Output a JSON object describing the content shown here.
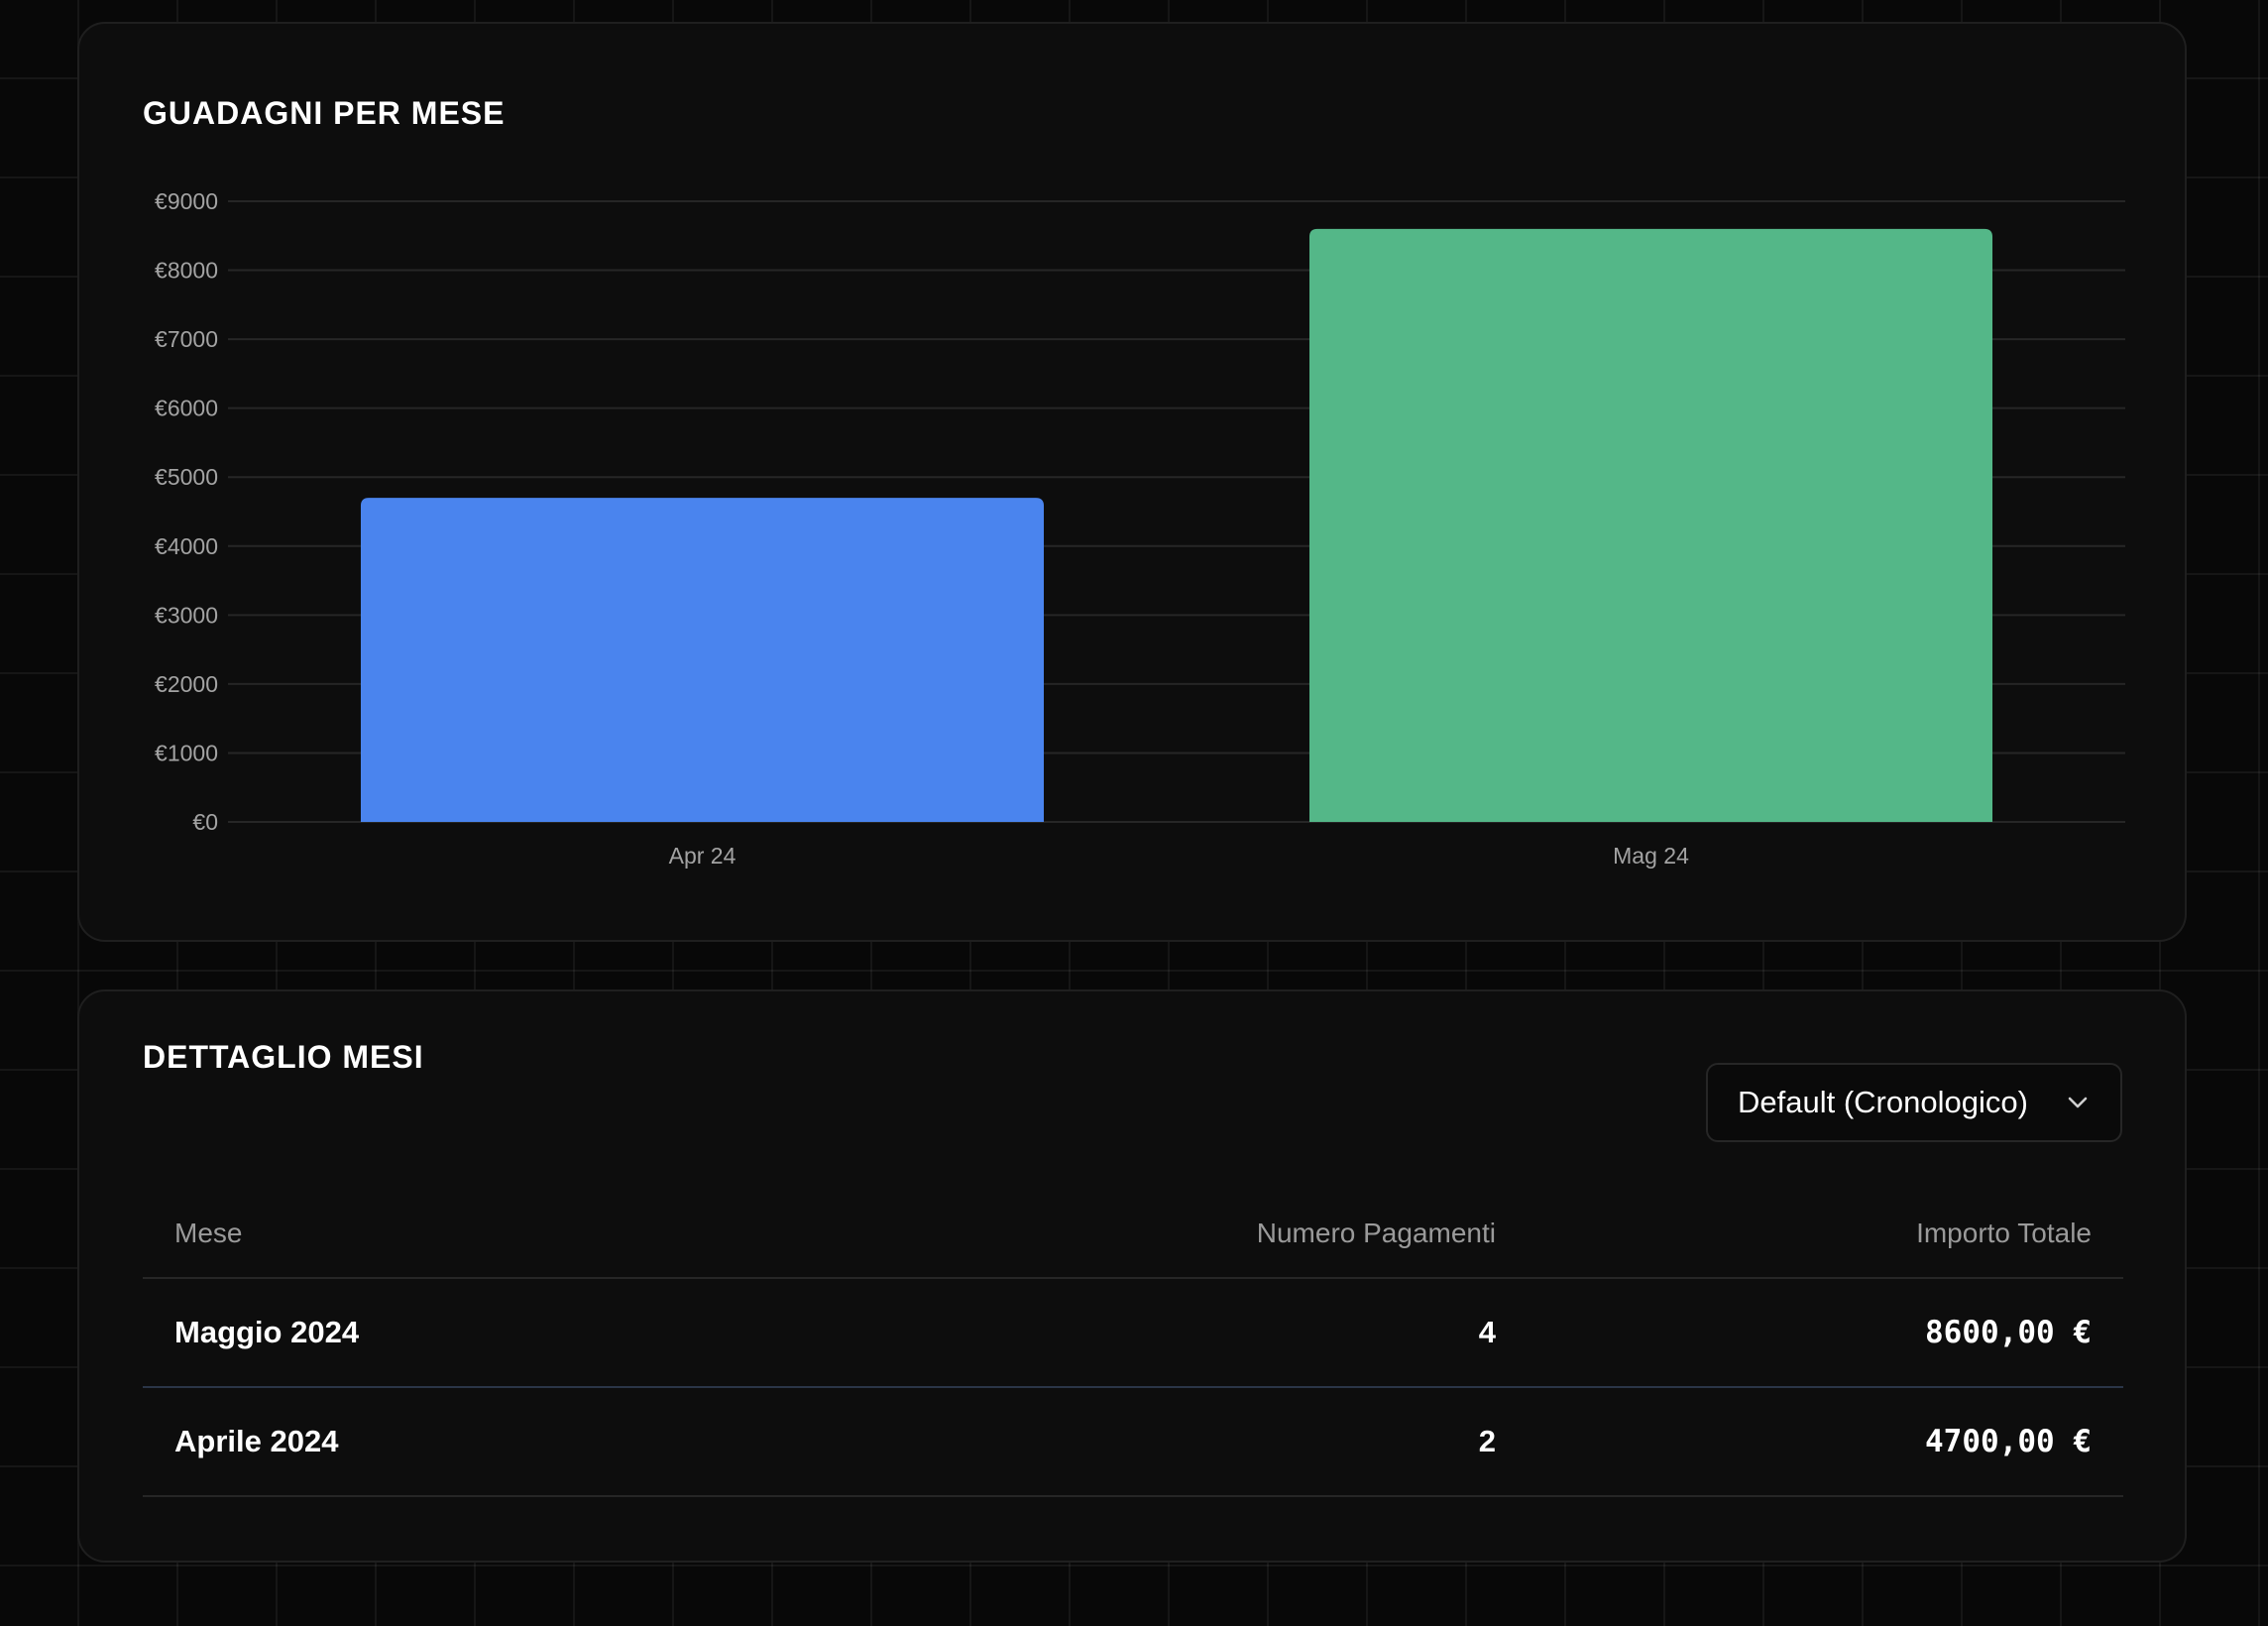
{
  "chart_card": {
    "title": "GUADAGNI PER MESE"
  },
  "chart_data": {
    "type": "bar",
    "categories": [
      "Apr 24",
      "Mag 24"
    ],
    "values": [
      4700,
      8600
    ],
    "ylim": [
      0,
      9000
    ],
    "yticks": [
      0,
      1000,
      2000,
      3000,
      4000,
      5000,
      6000,
      7000,
      8000,
      9000
    ],
    "ytick_labels": [
      "€0",
      "€1000",
      "€2000",
      "€3000",
      "€4000",
      "€5000",
      "€6000",
      "€7000",
      "€8000",
      "€9000"
    ],
    "bar_colors": [
      "#4a84ee",
      "#54b788"
    ],
    "grid": true,
    "gridline_color": "#262626",
    "title": "GUADAGNI PER MESE",
    "xlabel": "",
    "ylabel": ""
  },
  "table_card": {
    "title": "DETTAGLIO MESI",
    "sort_select": {
      "value": "Default (Cronologico)",
      "icon": "chevron-down-icon"
    },
    "columns": {
      "month": "Mese",
      "count": "Numero Pagamenti",
      "amount": "Importo Totale"
    },
    "rows": [
      {
        "month": "Maggio 2024",
        "count": "4",
        "amount": "8600,00 €"
      },
      {
        "month": "Aprile 2024",
        "count": "2",
        "amount": "4700,00 €"
      }
    ]
  },
  "colors": {
    "background": "#080808",
    "card": "#0d0d0d",
    "accent_blue": "#4a84ee",
    "accent_green": "#54b788"
  }
}
